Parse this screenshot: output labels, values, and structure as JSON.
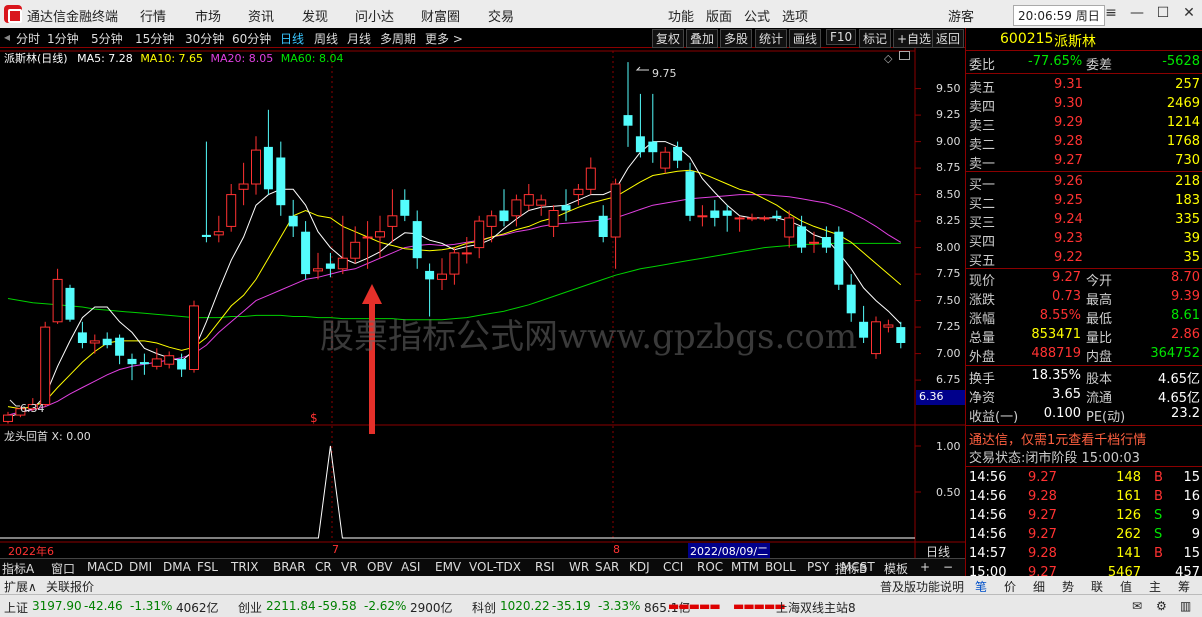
{
  "app": {
    "name": "通达信金融终端"
  },
  "menu": [
    "行情",
    "市场",
    "资讯",
    "发现",
    "问小达",
    "财富圈",
    "交易"
  ],
  "menu_right": [
    "功能",
    "版面",
    "公式",
    "选项"
  ],
  "user": "游客",
  "clock": "20:06:59 周日",
  "win_controls": {
    "menu": "≡",
    "min": "—",
    "max": "☐",
    "close": "✕"
  },
  "toolbar": {
    "periods": [
      "分时",
      "1分钟",
      "5分钟",
      "15分钟",
      "30分钟",
      "60分钟",
      "日线",
      "周线",
      "月线",
      "多周期",
      "更多 >"
    ],
    "active": "日线",
    "buttons": [
      "复权",
      "叠加",
      "多股",
      "统计",
      "画线",
      "F10",
      "标记",
      "+自选",
      "返回"
    ]
  },
  "chart": {
    "legend": {
      "name": "派斯林(日线)",
      "ma5": "MA5: 7.28",
      "ma10": "MA10: 7.65",
      "ma20": "MA20: 8.05",
      "ma60": "MA60: 8.04"
    },
    "high_label": "9.75",
    "low_label": "6.34",
    "price_tag": "6.36",
    "dollar": "$",
    "yticks": [
      "9.50",
      "9.25",
      "9.00",
      "8.75",
      "8.50",
      "8.25",
      "8.00",
      "7.75",
      "7.50",
      "7.25",
      "7.00",
      "6.75"
    ],
    "watermark": "股票指标公式网www.gpzbgs.com",
    "sub_legend": "龙头回首  X: 0.00",
    "sub_yticks": [
      "1.00",
      "0.50"
    ],
    "xlabels": [
      "2022年6",
      "7",
      "8"
    ],
    "cursor_date": "2022/08/09/二",
    "period_label": "日线"
  },
  "candles": [
    [
      6.36,
      6.42,
      6.45,
      6.34
    ],
    [
      6.42,
      6.48,
      6.5,
      6.4
    ],
    [
      6.48,
      6.52,
      6.58,
      6.46
    ],
    [
      6.52,
      7.25,
      7.3,
      6.5
    ],
    [
      7.3,
      7.7,
      7.8,
      7.28
    ],
    [
      7.62,
      7.32,
      7.65,
      7.3
    ],
    [
      7.2,
      7.1,
      7.3,
      7.05
    ],
    [
      7.1,
      7.12,
      7.18,
      7.0
    ],
    [
      7.14,
      7.08,
      7.2,
      7.05
    ],
    [
      7.15,
      6.98,
      7.18,
      6.9
    ],
    [
      6.95,
      6.9,
      7.0,
      6.75
    ],
    [
      6.92,
      6.9,
      7.0,
      6.8
    ],
    [
      6.88,
      6.95,
      7.05,
      6.85
    ],
    [
      6.9,
      6.98,
      7.02,
      6.86
    ],
    [
      6.95,
      6.85,
      7.0,
      6.78
    ],
    [
      6.85,
      7.45,
      7.5,
      6.82
    ],
    [
      8.12,
      8.1,
      9.0,
      8.05
    ],
    [
      8.12,
      8.15,
      8.3,
      8.05
    ],
    [
      8.2,
      8.5,
      8.6,
      8.15
    ],
    [
      8.55,
      8.6,
      8.8,
      8.4
    ],
    [
      8.6,
      8.92,
      9.05,
      8.5
    ],
    [
      8.95,
      8.55,
      9.3,
      8.5
    ],
    [
      8.85,
      8.4,
      9.0,
      8.3
    ],
    [
      8.3,
      8.2,
      8.45,
      8.1
    ],
    [
      8.15,
      7.75,
      8.25,
      7.7
    ],
    [
      7.78,
      7.8,
      7.95,
      7.7
    ],
    [
      7.85,
      7.8,
      7.95,
      7.72
    ],
    [
      7.8,
      7.9,
      8.3,
      7.75
    ],
    [
      7.9,
      8.05,
      8.2,
      7.85
    ],
    [
      8.1,
      8.1,
      8.25,
      7.8
    ],
    [
      8.1,
      8.15,
      8.3,
      7.9
    ],
    [
      8.2,
      8.3,
      8.55,
      8.05
    ],
    [
      8.45,
      8.3,
      8.55,
      8.25
    ],
    [
      8.25,
      7.9,
      8.35,
      7.8
    ],
    [
      7.78,
      7.7,
      7.85,
      7.35
    ],
    [
      7.7,
      7.75,
      7.9,
      7.6
    ],
    [
      7.75,
      7.95,
      8.0,
      7.65
    ],
    [
      7.95,
      7.95,
      8.1,
      7.85
    ],
    [
      8.0,
      8.25,
      8.3,
      7.9
    ],
    [
      8.2,
      8.3,
      8.35,
      8.05
    ],
    [
      8.35,
      8.25,
      8.55,
      8.2
    ],
    [
      8.3,
      8.45,
      8.5,
      8.2
    ],
    [
      8.4,
      8.5,
      8.6,
      8.35
    ],
    [
      8.4,
      8.45,
      8.5,
      8.3
    ],
    [
      8.2,
      8.35,
      8.4,
      8.1
    ],
    [
      8.4,
      8.35,
      8.55,
      8.25
    ],
    [
      8.5,
      8.55,
      8.6,
      8.4
    ],
    [
      8.55,
      8.75,
      8.85,
      8.5
    ],
    [
      8.3,
      8.1,
      8.4,
      8.05
    ],
    [
      8.1,
      8.6,
      8.65,
      7.8
    ],
    [
      9.25,
      9.15,
      9.75,
      8.95
    ],
    [
      9.05,
      8.9,
      9.45,
      8.85
    ],
    [
      9.0,
      8.9,
      9.45,
      8.8
    ],
    [
      8.75,
      8.9,
      8.95,
      8.7
    ],
    [
      8.95,
      8.82,
      9.0,
      8.75
    ],
    [
      8.72,
      8.3,
      8.8,
      8.25
    ],
    [
      8.3,
      8.3,
      8.4,
      8.2
    ],
    [
      8.35,
      8.28,
      8.45,
      8.2
    ],
    [
      8.35,
      8.3,
      8.4,
      8.15
    ],
    [
      8.28,
      8.28,
      8.3,
      8.15
    ],
    [
      8.28,
      8.28,
      8.32,
      8.25
    ],
    [
      8.28,
      8.28,
      8.3,
      8.25
    ],
    [
      8.3,
      8.28,
      8.35,
      8.25
    ],
    [
      8.1,
      8.28,
      8.35,
      8.0
    ],
    [
      8.2,
      8.0,
      8.3,
      7.95
    ],
    [
      8.05,
      8.05,
      8.15,
      7.95
    ],
    [
      8.1,
      8.0,
      8.2,
      7.95
    ],
    [
      8.15,
      7.65,
      8.2,
      7.6
    ],
    [
      7.65,
      7.38,
      7.75,
      7.3
    ],
    [
      7.3,
      7.15,
      7.45,
      7.1
    ],
    [
      7.0,
      7.3,
      7.35,
      6.95
    ],
    [
      7.25,
      7.27,
      7.32,
      7.2
    ],
    [
      7.25,
      7.1,
      7.3,
      7.05
    ]
  ],
  "ma": {
    "ma5": [
      6.4,
      6.44,
      6.48,
      6.6,
      6.88,
      7.12,
      7.34,
      7.44,
      7.44,
      7.3,
      7.2,
      7.05,
      7.0,
      6.96,
      6.93,
      7.03,
      7.3,
      7.6,
      7.88,
      8.1,
      8.4,
      8.5,
      8.55,
      8.55,
      8.4,
      8.15,
      8.0,
      7.9,
      7.85,
      7.9,
      7.96,
      8.06,
      8.14,
      8.13,
      8.07,
      8.04,
      7.98,
      8.01,
      8.03,
      8.08,
      8.18,
      8.27,
      8.35,
      8.38,
      8.39,
      8.4,
      8.45,
      8.5,
      8.5,
      8.55,
      8.75,
      8.9,
      9.0,
      9.0,
      8.95,
      8.85,
      8.65,
      8.52,
      8.4,
      8.3,
      8.28,
      8.28,
      8.28,
      8.25,
      8.2,
      8.12,
      8.08,
      7.95,
      7.8,
      7.62,
      7.5,
      7.4,
      7.28
    ],
    "ma10": [
      6.5,
      6.48,
      6.5,
      6.55,
      6.68,
      6.8,
      6.92,
      7.02,
      7.1,
      7.12,
      7.12,
      7.12,
      7.1,
      7.06,
      7.03,
      7.06,
      7.15,
      7.3,
      7.45,
      7.55,
      7.7,
      7.9,
      8.1,
      8.3,
      8.35,
      8.3,
      8.28,
      8.2,
      8.15,
      8.1,
      8.05,
      8.02,
      7.99,
      7.98,
      7.97,
      7.98,
      8.0,
      8.04,
      8.06,
      8.1,
      8.13,
      8.17,
      8.2,
      8.25,
      8.28,
      8.33,
      8.38,
      8.42,
      8.45,
      8.48,
      8.55,
      8.62,
      8.68,
      8.7,
      8.72,
      8.73,
      8.7,
      8.65,
      8.6,
      8.55,
      8.52,
      8.46,
      8.4,
      8.32,
      8.25,
      8.2,
      8.16,
      8.12,
      8.05,
      7.95,
      7.85,
      7.75,
      7.65
    ],
    "ma20": [
      6.42,
      6.45,
      6.47,
      6.5,
      6.55,
      6.62,
      6.68,
      6.74,
      6.8,
      6.85,
      6.88,
      6.9,
      6.92,
      6.94,
      6.96,
      7.0,
      7.08,
      7.2,
      7.3,
      7.4,
      7.5,
      7.55,
      7.6,
      7.65,
      7.7,
      7.72,
      7.75,
      7.78,
      7.8,
      7.85,
      7.9,
      7.95,
      8.0,
      8.02,
      8.03,
      8.02,
      8.03,
      8.05,
      8.07,
      8.1,
      8.12,
      8.15,
      8.17,
      8.2,
      8.22,
      8.23,
      8.24,
      8.25,
      8.26,
      8.28,
      8.32,
      8.36,
      8.4,
      8.42,
      8.44,
      8.46,
      8.47,
      8.48,
      8.49,
      8.5,
      8.5,
      8.5,
      8.49,
      8.48,
      8.46,
      8.44,
      8.42,
      8.38,
      8.33,
      8.27,
      8.2,
      8.12,
      8.05
    ],
    "ma60": [
      7.52,
      7.5,
      7.48,
      7.47,
      7.46,
      7.45,
      7.44,
      7.42,
      7.41,
      7.4,
      7.39,
      7.38,
      7.37,
      7.36,
      7.35,
      7.34,
      7.34,
      7.34,
      7.35,
      7.35,
      7.36,
      7.36,
      7.36,
      7.35,
      7.35,
      7.34,
      7.34,
      7.33,
      7.33,
      7.33,
      7.33,
      7.33,
      7.32,
      7.32,
      7.32,
      7.32,
      7.33,
      7.34,
      7.36,
      7.38,
      7.4,
      7.43,
      7.46,
      7.5,
      7.54,
      7.58,
      7.62,
      7.66,
      7.7,
      7.74,
      7.77,
      7.8,
      7.82,
      7.84,
      7.86,
      7.88,
      7.9,
      7.92,
      7.94,
      7.96,
      7.98,
      8.0,
      8.01,
      8.02,
      8.03,
      8.03,
      8.04,
      8.04,
      8.04,
      8.04,
      8.04,
      8.04,
      8.04
    ]
  },
  "signal_index": 26,
  "quote": {
    "code": "600215",
    "name": "派斯林",
    "weibi_label": "委比",
    "weibi": "-77.65%",
    "weicha_label": "委差",
    "weicha": "-5628",
    "asks": [
      {
        "l": "卖五",
        "p": "9.31",
        "v": "257"
      },
      {
        "l": "卖四",
        "p": "9.30",
        "v": "2469"
      },
      {
        "l": "卖三",
        "p": "9.29",
        "v": "1214"
      },
      {
        "l": "卖二",
        "p": "9.28",
        "v": "1768"
      },
      {
        "l": "卖一",
        "p": "9.27",
        "v": "730"
      }
    ],
    "bids": [
      {
        "l": "买一",
        "p": "9.26",
        "v": "218"
      },
      {
        "l": "买二",
        "p": "9.25",
        "v": "183"
      },
      {
        "l": "买三",
        "p": "9.24",
        "v": "335"
      },
      {
        "l": "买四",
        "p": "9.23",
        "v": "39"
      },
      {
        "l": "买五",
        "p": "9.22",
        "v": "35"
      }
    ],
    "stats": [
      {
        "l1": "现价",
        "v1": "9.27",
        "c1": "up",
        "l2": "今开",
        "v2": "8.70",
        "c2": "up"
      },
      {
        "l1": "涨跌",
        "v1": "0.73",
        "c1": "up",
        "l2": "最高",
        "v2": "9.39",
        "c2": "up"
      },
      {
        "l1": "涨幅",
        "v1": "8.55%",
        "c1": "up",
        "l2": "最低",
        "v2": "8.61",
        "c2": "dn"
      },
      {
        "l1": "总量",
        "v1": "853471",
        "c1": "yel",
        "l2": "量比",
        "v2": "2.86",
        "c2": "up"
      },
      {
        "l1": "外盘",
        "v1": "488719",
        "c1": "up",
        "l2": "内盘",
        "v2": "364752",
        "c2": "dn"
      }
    ],
    "stats2": [
      {
        "l1": "换手",
        "v1": "18.35%",
        "l2": "股本",
        "v2": "4.65亿"
      },
      {
        "l1": "净资",
        "v1": "3.65",
        "l2": "流通",
        "v2": "4.65亿"
      },
      {
        "l1": "收益(一)",
        "v1": "0.100",
        "l2": "PE(动)",
        "v2": "23.2"
      }
    ],
    "promo": "通达信，仅需1元查看千档行情",
    "trade_status": "交易状态:闭市阶段 15:00:03",
    "ticks": [
      {
        "t": "14:56",
        "p": "9.27",
        "v": "148",
        "s": "B",
        "n": "15"
      },
      {
        "t": "14:56",
        "p": "9.28",
        "v": "161",
        "s": "B",
        "n": "16"
      },
      {
        "t": "14:56",
        "p": "9.27",
        "v": "126",
        "s": "S",
        "n": "9"
      },
      {
        "t": "14:56",
        "p": "9.27",
        "v": "262",
        "s": "S",
        "n": "9"
      },
      {
        "t": "14:57",
        "p": "9.28",
        "v": "141",
        "s": "B",
        "n": "15"
      },
      {
        "t": "15:00",
        "p": "9.27",
        "v": "5467",
        "s": "",
        "n": "457"
      }
    ]
  },
  "indicator_tabs": [
    "指标A",
    "窗口",
    "MACD",
    "DMI",
    "DMA",
    "FSL",
    "TRIX",
    "BRAR",
    "CR",
    "VR",
    "OBV",
    "ASI",
    "EMV",
    "VOL-TDX",
    "RSI",
    "WR",
    "SAR",
    "KDJ",
    "CCI",
    "ROC",
    "MTM",
    "BOLL",
    "PSY",
    "MCST"
  ],
  "indicator_tabs_right": [
    "指标B",
    "模板",
    "+",
    "−"
  ],
  "footer": {
    "expand": "扩展∧",
    "related": "关联报价",
    "help": "普及版功能说明",
    "tabs": [
      "笔",
      "价",
      "细",
      "势",
      "联",
      "值",
      "主",
      "筹"
    ]
  },
  "status": [
    {
      "k": "上证",
      "v": "3197.90",
      "c": "-42.46",
      "p": "-1.31%",
      "a": "4062亿"
    },
    {
      "k": "创业",
      "v": "2211.84",
      "c": "-59.58",
      "p": "-2.62%",
      "a": "2900亿"
    },
    {
      "k": "科创",
      "v": "1020.22",
      "c": "-35.19",
      "p": "-3.33%",
      "a": "865.1亿"
    }
  ],
  "station": "上海双线主站8",
  "colors": {
    "up": "#ff3232",
    "down": "#54fcfc",
    "ma5": "#ffffff",
    "ma10": "#ffff00",
    "ma20": "#e040e0",
    "ma60": "#00d000",
    "frame": "#8b0000"
  }
}
